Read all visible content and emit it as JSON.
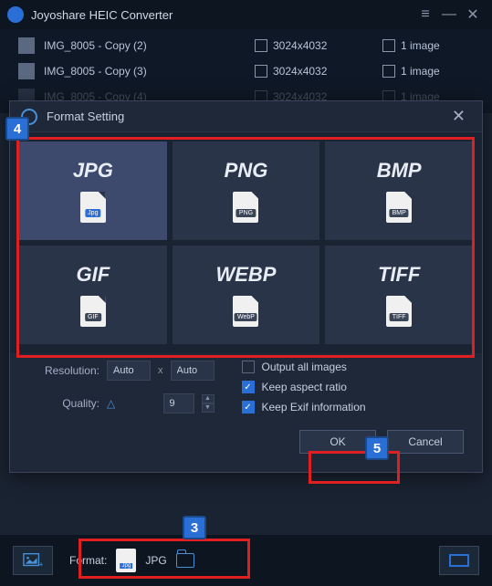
{
  "titlebar": {
    "title": "Joyoshare HEIC Converter"
  },
  "files": [
    {
      "name": "IMG_8005 - Copy (2)",
      "dims": "3024x4032",
      "count": "1 image"
    },
    {
      "name": "IMG_8005 - Copy (3)",
      "dims": "3024x4032",
      "count": "1 image"
    },
    {
      "name": "IMG_8005 - Copy (4)",
      "dims": "3024x4032",
      "count": "1 image"
    }
  ],
  "modal": {
    "title": "Format Setting",
    "formats": [
      {
        "label": "JPG",
        "tag": "Jpg",
        "selected": true
      },
      {
        "label": "PNG",
        "tag": "PNG",
        "selected": false
      },
      {
        "label": "BMP",
        "tag": "BMP",
        "selected": false
      },
      {
        "label": "GIF",
        "tag": "GIF",
        "selected": false
      },
      {
        "label": "WEBP",
        "tag": "WebP",
        "selected": false
      },
      {
        "label": "TIFF",
        "tag": "TIFF",
        "selected": false
      }
    ],
    "resolution_label": "Resolution:",
    "res_w": "Auto",
    "res_h": "Auto",
    "quality_label": "Quality:",
    "quality_val": "9",
    "opt_output_all": "Output all images",
    "opt_aspect": "Keep aspect ratio",
    "opt_exif": "Keep Exif information",
    "ok": "OK",
    "cancel": "Cancel"
  },
  "bottom": {
    "format_label": "Format:",
    "format_value": "JPG",
    "format_tag": "Jpg"
  },
  "callouts": {
    "c3": "3",
    "c4": "4",
    "c5": "5"
  }
}
